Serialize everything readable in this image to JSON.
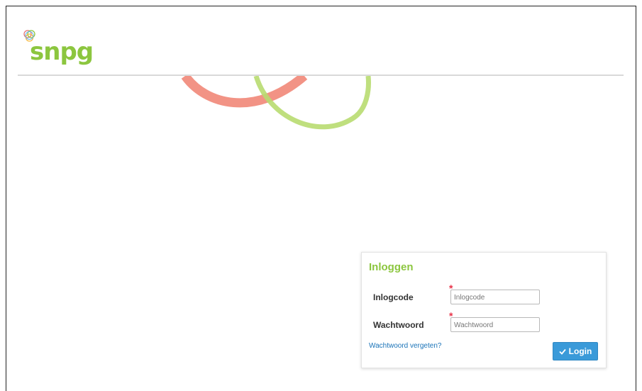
{
  "brand": {
    "name": "snpg",
    "color": "#8cc63f"
  },
  "login": {
    "title": "Inloggen",
    "username_label": "Inlogcode",
    "username_placeholder": "Inlogcode",
    "password_label": "Wachtwoord",
    "password_placeholder": "Wachtwoord",
    "required_marker": "*",
    "forgot_link": "Wachtwoord vergeten?",
    "submit_label": "Login",
    "submit_icon": "check-icon"
  },
  "colors": {
    "accent": "#3a9ad9",
    "link": "#1a73b8",
    "required": "#e8344a",
    "decor_red": "#f08070",
    "decor_green": "#b8dc70"
  }
}
